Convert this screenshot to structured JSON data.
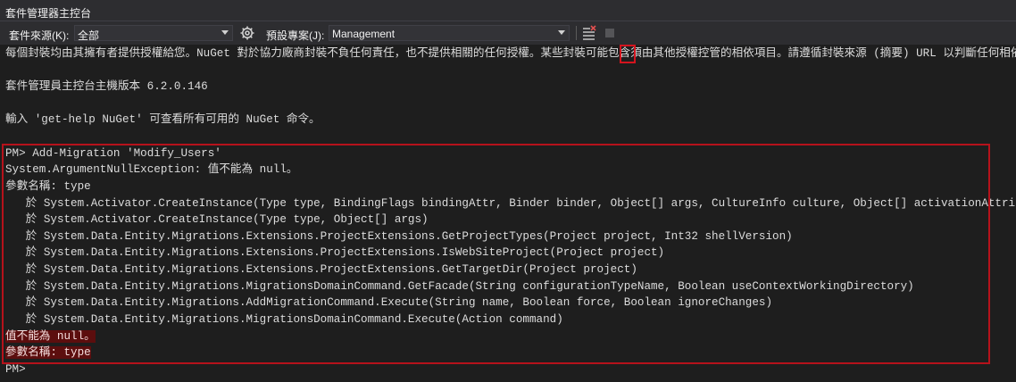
{
  "window": {
    "title": "套件管理器主控台"
  },
  "toolbar": {
    "source_label": "套件來源(K):",
    "source_value": "全部",
    "project_label": "預設專案(J):",
    "project_value": "Management",
    "icons": [
      "gear-icon",
      "clear-console-icon",
      "stop-icon"
    ]
  },
  "console": {
    "lines": [
      "每個封裝均由其擁有者提供授權給您。NuGet 對於協力廠商封裝不負任何責任，也不提供相關的任何授權。某些封裝可能包含須由其他授權控管的相依項目。請遵循封裝來源 (摘要) URL 以判斷任何相依項目。",
      "",
      "套件管理員主控台主機版本 6.2.0.146",
      "",
      "輸入 'get-help NuGet' 可查看所有可用的 NuGet 命令。",
      "",
      "PM> Add-Migration 'Modify_Users'",
      "System.ArgumentNullException: 值不能為 null。",
      "參數名稱: type",
      "   於 System.Activator.CreateInstance(Type type, BindingFlags bindingAttr, Binder binder, Object[] args, CultureInfo culture, Object[] activationAttributes)",
      "   於 System.Activator.CreateInstance(Type type, Object[] args)",
      "   於 System.Data.Entity.Migrations.Extensions.ProjectExtensions.GetProjectTypes(Project project, Int32 shellVersion)",
      "   於 System.Data.Entity.Migrations.Extensions.ProjectExtensions.IsWebSiteProject(Project project)",
      "   於 System.Data.Entity.Migrations.Extensions.ProjectExtensions.GetTargetDir(Project project)",
      "   於 System.Data.Entity.Migrations.MigrationsDomainCommand.GetFacade(String configurationTypeName, Boolean useContextWorkingDirectory)",
      "   於 System.Data.Entity.Migrations.AddMigrationCommand.Execute(String name, Boolean force, Boolean ignoreChanges)",
      "   於 System.Data.Entity.Migrations.MigrationsDomainCommand.Execute(Action command)",
      "值不能為 null。",
      "參數名稱: type",
      "PM>"
    ]
  },
  "colors": {
    "background": "#1e1e1e",
    "highlight_box": "#b6121b",
    "error_bg": "#5c0e0e"
  }
}
